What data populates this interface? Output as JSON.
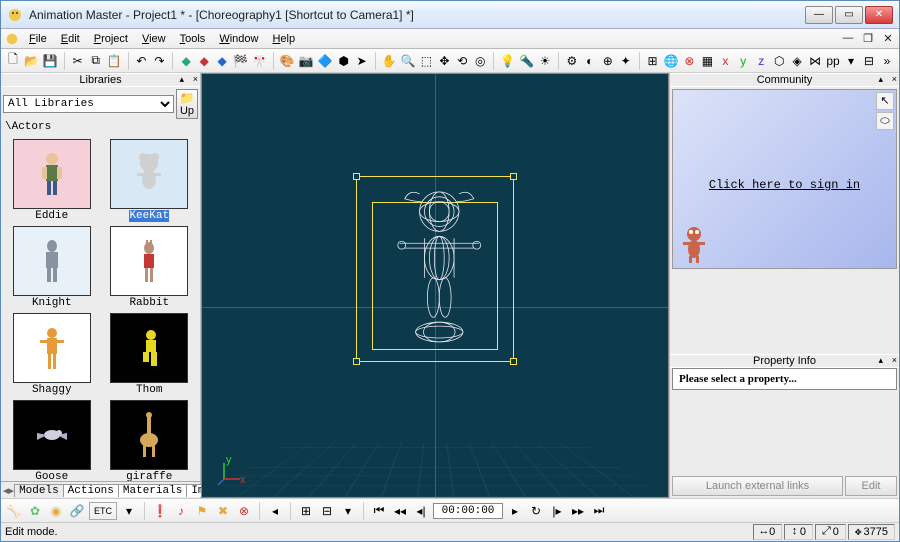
{
  "window": {
    "title": "Animation Master - Project1 * - [Choreography1 [Shortcut to Camera1] *]"
  },
  "menu": {
    "items": [
      "File",
      "Edit",
      "Project",
      "View",
      "Tools",
      "Window",
      "Help"
    ]
  },
  "libraries": {
    "panel_title": "Libraries",
    "selector": "All Libraries",
    "up_label": "Up",
    "path": "\\Actors",
    "items": [
      {
        "name": "Eddie",
        "selected": false
      },
      {
        "name": "KeeKat",
        "selected": true
      },
      {
        "name": "Knight",
        "selected": false
      },
      {
        "name": "Rabbit",
        "selected": false
      },
      {
        "name": "Shaggy",
        "selected": false
      },
      {
        "name": "Thom",
        "selected": false
      },
      {
        "name": "Goose",
        "selected": false
      },
      {
        "name": "giraffe",
        "selected": false
      }
    ],
    "tabs": [
      "Models",
      "Actions",
      "Materials",
      "Imag"
    ]
  },
  "community": {
    "panel_title": "Community",
    "sign_in": "Click here to sign in",
    "launch_btn": "Launch external links",
    "edit_btn": "Edit"
  },
  "property_info": {
    "panel_title": "Property Info",
    "message": "Please select a property..."
  },
  "transport": {
    "timecode": "00:00:00"
  },
  "status": {
    "mode": "Edit mode.",
    "x": "0",
    "y": "0",
    "z": "0",
    "frame": "3775"
  },
  "icons": {
    "new": "🗋",
    "open": "📂",
    "save": "💾",
    "cut": "✂",
    "copy": "⧉",
    "paste": "📋",
    "undo": "↶",
    "redo": "↷"
  }
}
